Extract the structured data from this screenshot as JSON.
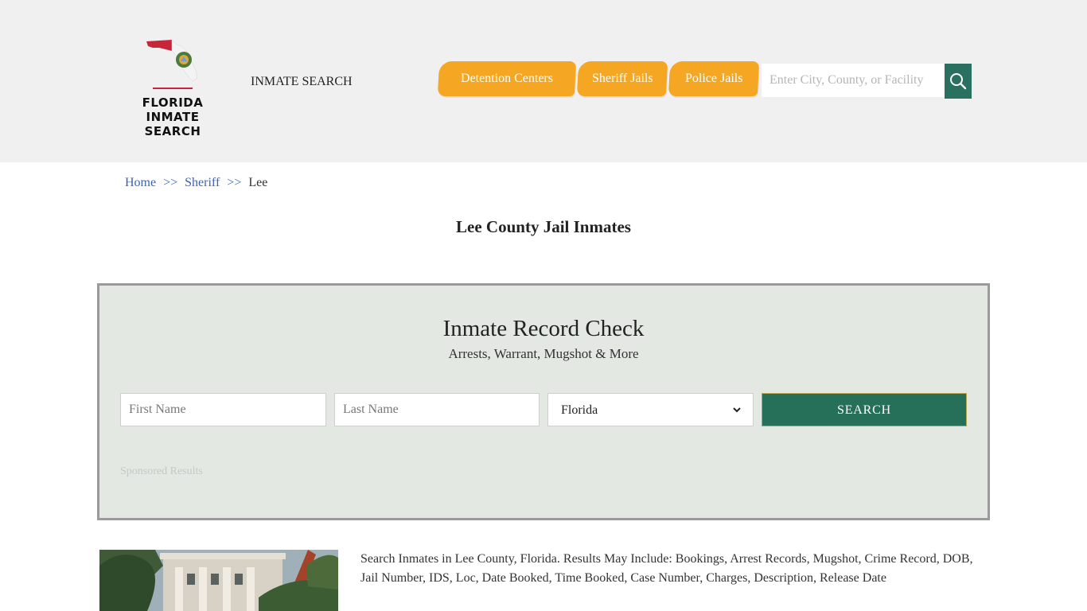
{
  "logo": {
    "line1": "FLORIDA",
    "line2": "INMATE SEARCH"
  },
  "nav": {
    "inmate_search": "INMATE SEARCH",
    "pills": [
      "Detention Centers",
      "Sheriff Jails",
      "Police Jails"
    ]
  },
  "search": {
    "placeholder": "Enter City, County, or Facility"
  },
  "breadcrumb": {
    "home": "Home",
    "sep": ">>",
    "sheriff": "Sheriff",
    "current": "Lee"
  },
  "page_title": "Lee County Jail Inmates",
  "record_check": {
    "title": "Inmate Record Check",
    "subtitle": "Arrests, Warrant, Mugshot & More",
    "first_placeholder": "First Name",
    "last_placeholder": "Last Name",
    "state_selected": "Florida",
    "submit_label": "SEARCH",
    "sponsored": "Sponsored Results"
  },
  "description": "Search Inmates in Lee County, Florida. Results May Include: Bookings, Arrest Records, Mugshot, Crime Record, DOB, Jail Number, IDS, Loc, Date Booked, Time Booked, Case Number, Charges, Description, Release Date",
  "colors": {
    "header_bg": "#f0f0f0",
    "pill": "#f5a623",
    "accent_green": "#26705a",
    "link": "#3a63b8"
  },
  "icons": {
    "logo": "florida-state-map-icon",
    "search": "magnifier-icon",
    "select": "chevron-down-icon"
  }
}
